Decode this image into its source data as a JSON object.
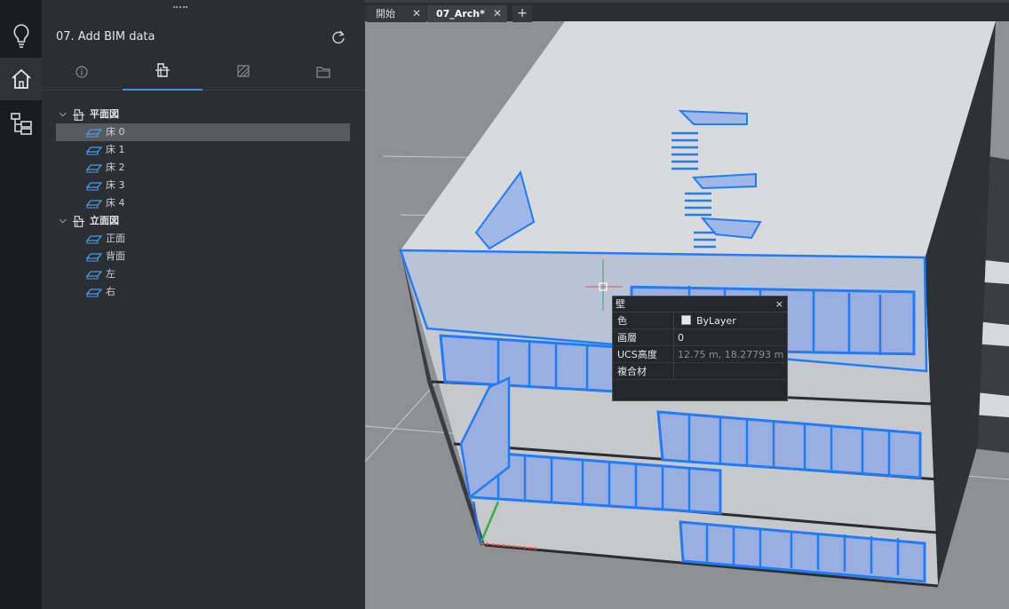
{
  "rail": {
    "items": [
      {
        "name": "lightbulb-icon"
      },
      {
        "name": "home-icon"
      },
      {
        "name": "tree-structure-icon"
      }
    ]
  },
  "panel": {
    "title": "07. Add BIM data",
    "tabs": [
      "info-icon",
      "building-section-icon",
      "material-hatch-icon",
      "folder-icon"
    ],
    "active_tab": 1
  },
  "tree": {
    "groups": [
      {
        "label": "平面図",
        "items": [
          "床 0",
          "床 1",
          "床 2",
          "床 3",
          "床 4"
        ]
      },
      {
        "label": "立面図",
        "items": [
          "正面",
          "背面",
          "左",
          "右"
        ]
      }
    ],
    "selected": "床 0"
  },
  "doc_tabs": [
    {
      "label": "開始",
      "active": false
    },
    {
      "label": "07_Arch*",
      "active": true
    }
  ],
  "props": {
    "title": "壁",
    "close": "×",
    "rows": [
      {
        "key": "色",
        "value": "ByLayer"
      },
      {
        "key": "画層",
        "value": "0"
      },
      {
        "key": "UCS高度",
        "value": "12.75 m, 18.27793 m"
      },
      {
        "key": "複合材",
        "value": ""
      }
    ]
  },
  "colors": {
    "accent": "#3b8fe4",
    "selection_blue": "#1f7cff"
  }
}
